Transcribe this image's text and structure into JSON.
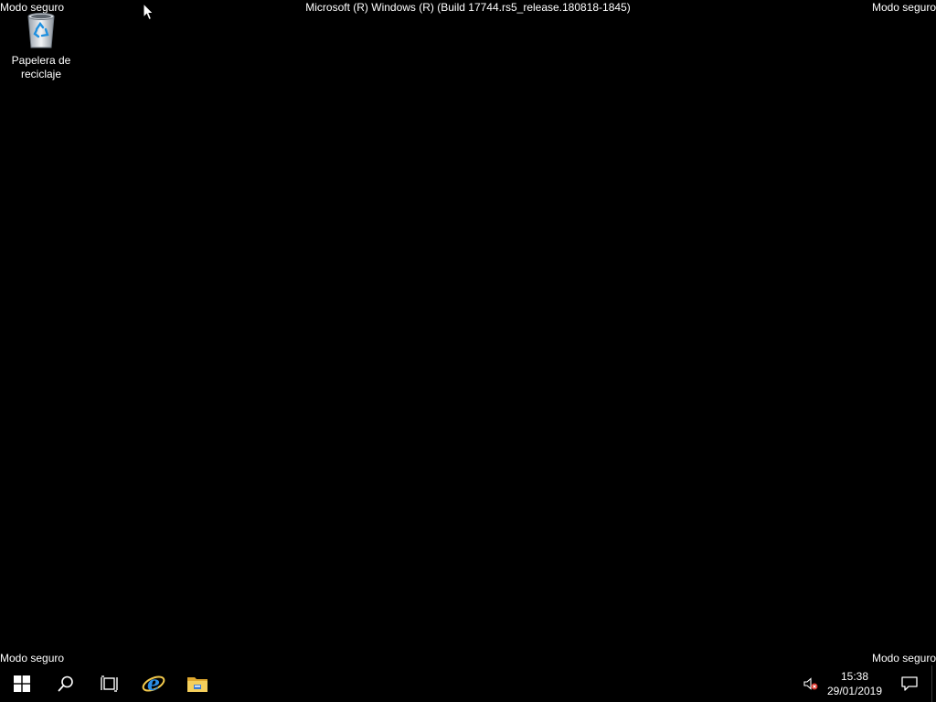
{
  "watermarks": {
    "top_left": "Modo seguro",
    "top_right": "Modo seguro",
    "bottom_left": "Modo seguro",
    "bottom_right": "Modo seguro",
    "build": "Microsoft (R) Windows (R) (Build 17744.rs5_release.180818-1845)"
  },
  "desktop": {
    "icons": [
      {
        "label": "Papelera de reciclaje",
        "icon": "recycle-bin-icon"
      }
    ]
  },
  "taskbar": {
    "buttons": [
      {
        "name": "start",
        "icon": "windows-logo-icon"
      },
      {
        "name": "search",
        "icon": "search-icon"
      },
      {
        "name": "task-view",
        "icon": "task-view-icon"
      },
      {
        "name": "internet-explorer",
        "icon": "internet-explorer-icon"
      },
      {
        "name": "file-explorer",
        "icon": "folder-icon"
      }
    ],
    "tray": {
      "sound_icon": "speaker-muted-icon",
      "time": "15:38",
      "date": "29/01/2019",
      "notification_icon": "action-center-icon"
    }
  },
  "colors": {
    "background": "#000000",
    "text": "#ffffff",
    "accent_blue": "#1e90e0",
    "folder_yellow": "#f2c94c"
  }
}
